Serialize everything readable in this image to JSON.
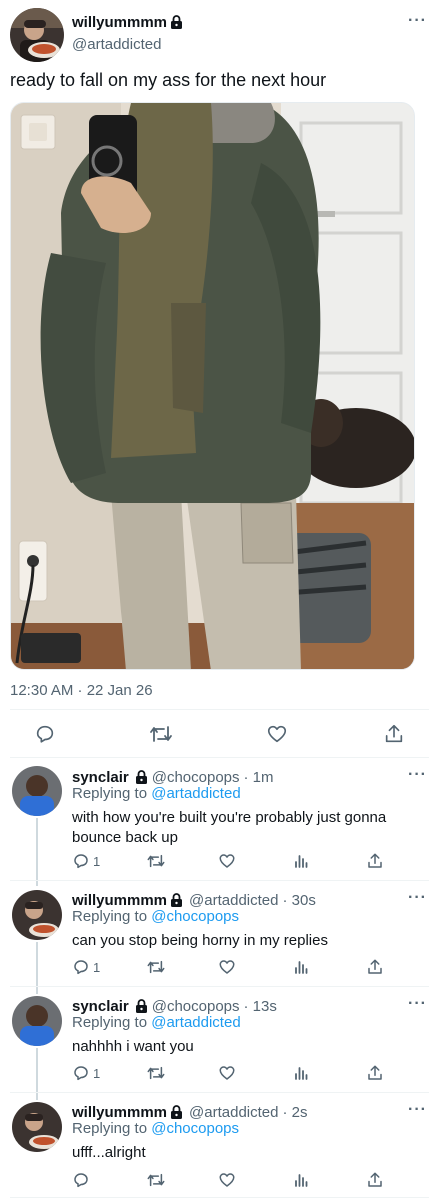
{
  "tweet": {
    "display_name": "willyummmm",
    "handle": "@artaddicted",
    "text": "ready to fall on my ass for the next hour",
    "timestamp": "12:30 AM · 22 Jan 26",
    "more": "···",
    "avatar_icon": "user-avatar-icon",
    "photo_icon": "mirror-selfie-photo"
  },
  "replies": [
    {
      "display_name": "synclair",
      "handle": "@chocopops",
      "time": "· 1m",
      "replying_label": "Replying to ",
      "replying_to": "@artaddicted",
      "text_line1": "with how you're built you're probably just gonna",
      "text_line2": "bounce back up",
      "reply_count": "1",
      "more": "···"
    },
    {
      "display_name": "willyummmm",
      "handle": "@artaddicted",
      "time": "· 30s",
      "replying_label": "Replying to ",
      "replying_to": "@chocopops",
      "text_line1": "can you stop being horny in my replies",
      "text_line2": "",
      "reply_count": "1",
      "more": "···"
    },
    {
      "display_name": "synclair",
      "handle": "@chocopops",
      "time": "· 13s",
      "replying_label": "Replying to ",
      "replying_to": "@artaddicted",
      "text_line1": "nahhhh i want you",
      "text_line2": "",
      "reply_count": "1",
      "more": "···"
    },
    {
      "display_name": "willyummmm",
      "handle": "@artaddicted",
      "time": "· 2s",
      "replying_label": "Replying to ",
      "replying_to": "@chocopops",
      "text_line1": "ufff...alright",
      "text_line2": "",
      "reply_count": "",
      "more": "···"
    }
  ],
  "colors": {
    "link": "#1d9bf0",
    "muted": "#536471",
    "text": "#0f1419"
  }
}
